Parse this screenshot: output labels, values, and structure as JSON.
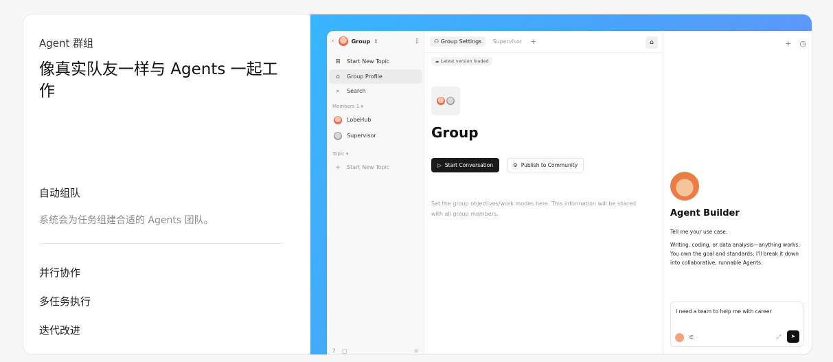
{
  "left": {
    "eyebrow": "Agent 群组",
    "headline": "像真实队友一样与 Agents 一起工作",
    "feature": {
      "title": "自动组队",
      "description": "系统会为任务组建合适的 Agents 团队。"
    },
    "items": [
      "并行协作",
      "多任务执行",
      "迭代改进"
    ]
  },
  "app": {
    "sidebar": {
      "group_name": "Group",
      "nav": [
        {
          "label": "Start New Topic",
          "icon": "new-topic-icon"
        },
        {
          "label": "Group Profile",
          "icon": "robot-icon",
          "active": true
        },
        {
          "label": "Search",
          "icon": "search-icon"
        }
      ],
      "members_label": "Members 1",
      "members": [
        {
          "label": "LobeHub",
          "avatar": "lobehub-avatar"
        },
        {
          "label": "Supervisor",
          "avatar": "supervisor-avatar"
        }
      ],
      "topic_label": "Topic",
      "topic_new": "Start New Topic"
    },
    "main": {
      "tabs": [
        {
          "label": "Group Settings",
          "active": true
        },
        {
          "label": "Supervisor",
          "active": false
        }
      ],
      "version_badge": "Latest version loaded",
      "group_title": "Group",
      "start_button": "Start Conversation",
      "publish_button": "Publish to Community",
      "description": "Set the group objectives/work modes here. This information will be shared with all group members."
    },
    "panel": {
      "title": "Agent Builder",
      "intro": "Tell me your use case.",
      "body": "Writing, coding, or data analysis—anything works. You own the goal and standards; I'll break it down into collaborative, runnable Agents.",
      "chat_input": "I need a team to help me with career"
    }
  },
  "colors": {
    "gradient_start": "#38b6ff",
    "gradient_end": "#6e8dfb",
    "primary_button": "#1a1a1a"
  }
}
